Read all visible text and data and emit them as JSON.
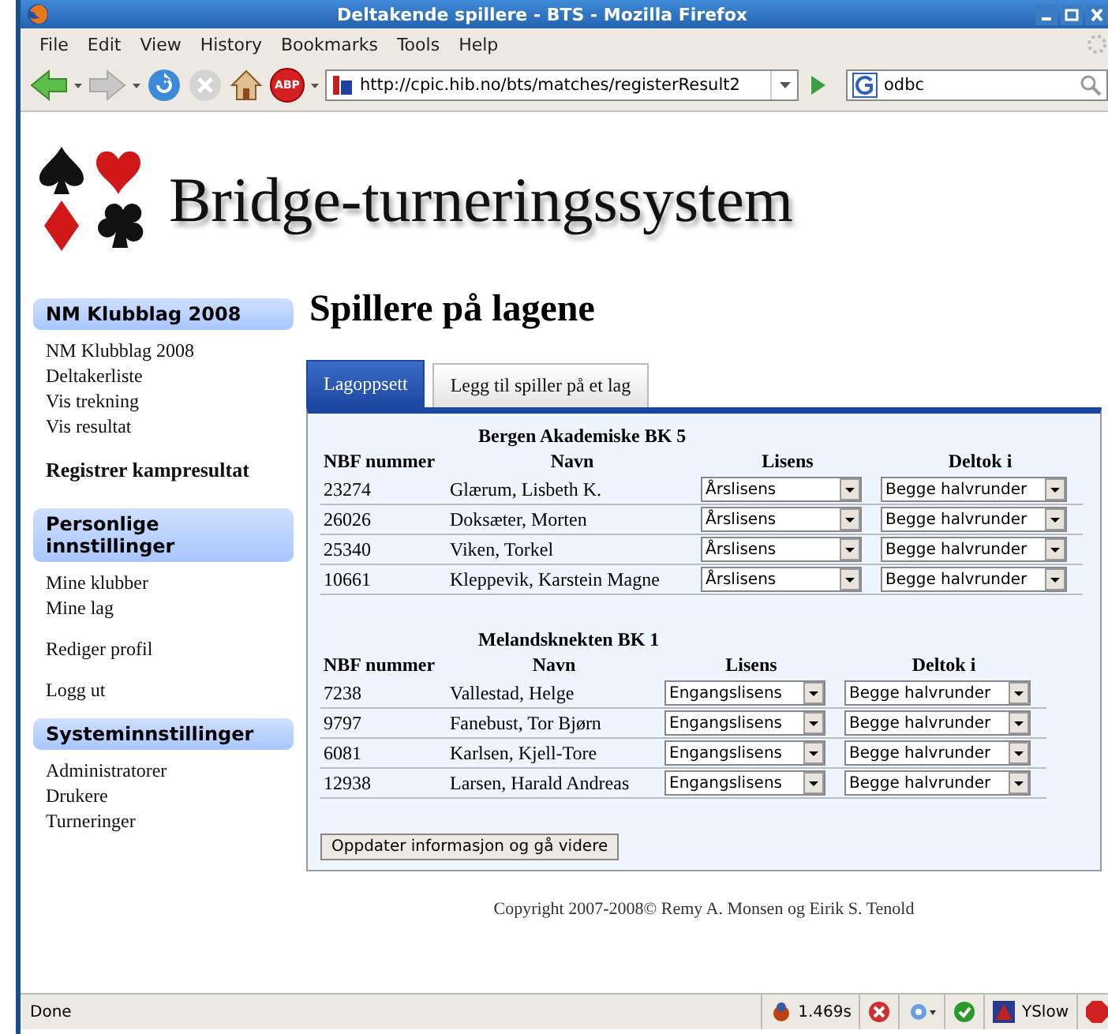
{
  "window": {
    "title": "Deltakende spillere - BTS - Mozilla Firefox"
  },
  "menu": [
    "File",
    "Edit",
    "View",
    "History",
    "Bookmarks",
    "Tools",
    "Help"
  ],
  "toolbar": {
    "adblock_label": "ABP",
    "address": "http://cpic.hib.no/bts/matches/registerResult2",
    "search": "odbc"
  },
  "site_title": "Bridge-turneringssystem",
  "sidebar": [
    {
      "kind": "heading",
      "text": "NM Klubblag 2008"
    },
    {
      "kind": "links",
      "items": [
        "NM Klubblag 2008",
        "Deltakerliste",
        "Vis trekning",
        "Vis resultat"
      ]
    },
    {
      "kind": "bold-link",
      "text": "Registrer kampresultat"
    },
    {
      "kind": "heading",
      "text": "Personlige innstillinger"
    },
    {
      "kind": "links",
      "items": [
        "Mine klubber",
        "Mine lag"
      ]
    },
    {
      "kind": "links",
      "items": [
        "Rediger profil"
      ]
    },
    {
      "kind": "links",
      "items": [
        "Logg ut"
      ]
    },
    {
      "kind": "heading",
      "text": "Systeminnstillinger"
    },
    {
      "kind": "links",
      "items": [
        "Administratorer",
        "Drukere",
        "Turneringer"
      ]
    }
  ],
  "heading": "Spillere på lagene",
  "tabs": [
    {
      "label": "Lagoppsett",
      "selected": true
    },
    {
      "label": "Legg til spiller på et lag",
      "selected": false
    }
  ],
  "teams": [
    {
      "name": "Bergen Akademiske BK 5",
      "columns": [
        "NBF nummer",
        "Navn",
        "Lisens",
        "Deltok i"
      ],
      "rows": [
        {
          "nbf": "23274",
          "name": "Glærum, Lisbeth K.",
          "license": "Årslisens",
          "participation": "Begge halvrunder"
        },
        {
          "nbf": "26026",
          "name": "Doksæter, Morten",
          "license": "Årslisens",
          "participation": "Begge halvrunder"
        },
        {
          "nbf": "25340",
          "name": "Viken, Torkel",
          "license": "Årslisens",
          "participation": "Begge halvrunder"
        },
        {
          "nbf": "10661",
          "name": "Kleppevik, Karstein Magne",
          "license": "Årslisens",
          "participation": "Begge halvrunder"
        }
      ]
    },
    {
      "name": "Melandsknekten BK 1",
      "columns": [
        "NBF nummer",
        "Navn",
        "Lisens",
        "Deltok i"
      ],
      "rows": [
        {
          "nbf": "7238",
          "name": "Vallestad, Helge",
          "license": "Engangslisens",
          "participation": "Begge halvrunder"
        },
        {
          "nbf": "9797",
          "name": "Fanebust, Tor Bjørn",
          "license": "Engangslisens",
          "participation": "Begge halvrunder"
        },
        {
          "nbf": "6081",
          "name": "Karlsen, Kjell-Tore",
          "license": "Engangslisens",
          "participation": "Begge halvrunder"
        },
        {
          "nbf": "12938",
          "name": "Larsen, Harald Andreas",
          "license": "Engangslisens",
          "participation": "Begge halvrunder"
        }
      ]
    }
  ],
  "submit_button": "Oppdater informasjon og gå videre",
  "footer": "Copyright 2007-2008© Remy A. Monsen og Eirik S. Tenold",
  "status_bar": {
    "status": "Done",
    "timing": "1.469s",
    "yslow": "YSlow"
  }
}
